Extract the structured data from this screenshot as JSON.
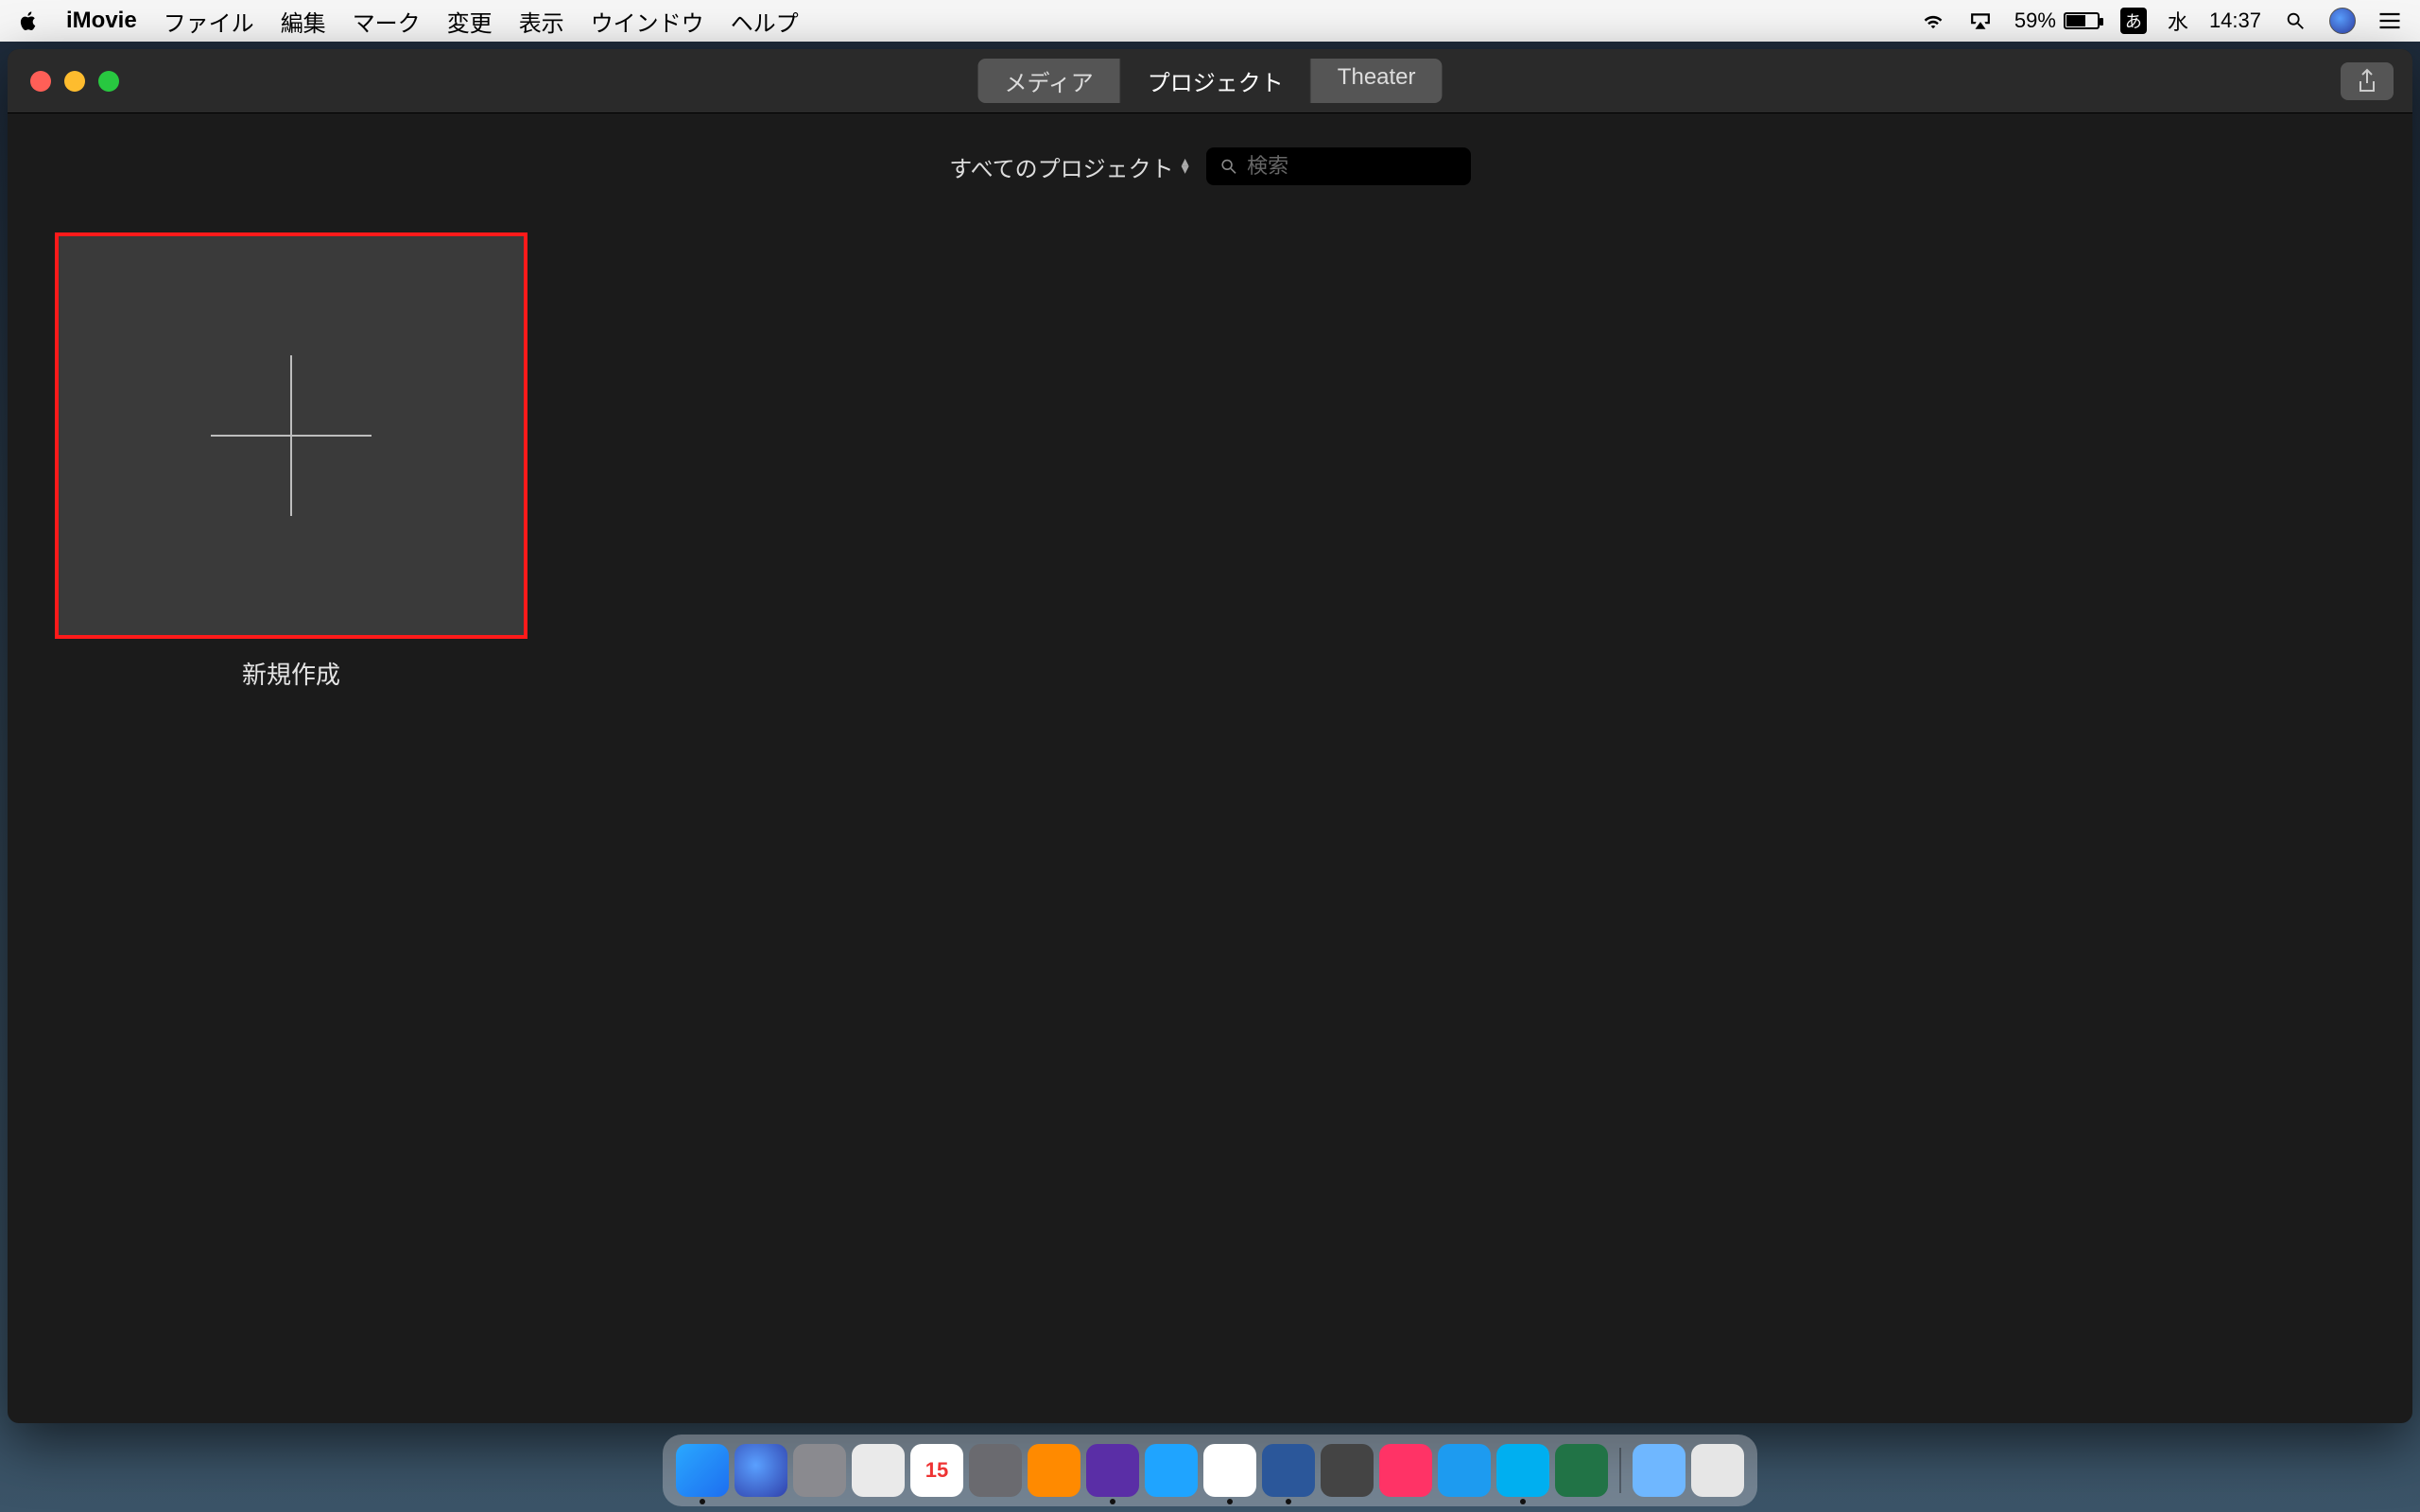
{
  "menubar": {
    "app_name": "iMovie",
    "items": [
      "ファイル",
      "編集",
      "マーク",
      "変更",
      "表示",
      "ウインドウ",
      "ヘルプ"
    ],
    "battery_percent": "59%",
    "ime_label": "あ",
    "day_label": "水",
    "time": "14:37"
  },
  "window": {
    "tabs": {
      "media": "メディア",
      "projects": "プロジェクト",
      "theater": "Theater"
    },
    "filter_label": "すべてのプロジェクト",
    "search_placeholder": "検索"
  },
  "projects": {
    "new_label": "新規作成"
  },
  "dock": {
    "cal_day": "15"
  }
}
